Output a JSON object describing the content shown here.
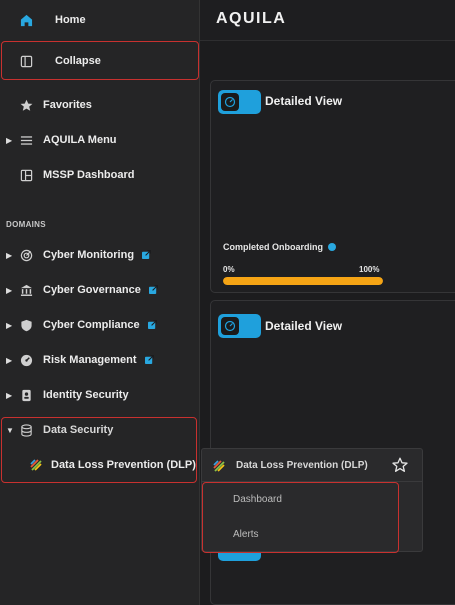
{
  "sidebar": {
    "top_items": [
      {
        "label": "Home",
        "icon": "home-icon"
      },
      {
        "label": "Collapse",
        "icon": "sidebar-panel-icon"
      },
      {
        "label": "Favorites",
        "icon": "star-icon"
      },
      {
        "label": "AQUILA Menu",
        "icon": "hamburger-menu-icon"
      },
      {
        "label": "MSSP Dashboard",
        "icon": "dashboard-layout-icon"
      }
    ],
    "domains_header": "DOMAINS",
    "domains": [
      {
        "label": "Cyber Monitoring",
        "icon": "radar-icon"
      },
      {
        "label": "Cyber Governance",
        "icon": "bank-building-icon"
      },
      {
        "label": "Cyber Compliance",
        "icon": "shield-icon"
      },
      {
        "label": "Risk Management",
        "icon": "gauge-icon"
      },
      {
        "label": "Identity Security",
        "icon": "id-badge-icon"
      },
      {
        "label": "Data Security",
        "icon": "database-icon"
      }
    ],
    "sub_item": {
      "label": "Data Loss Prevention (DLP)",
      "icon": "dlp-stripes-icon"
    }
  },
  "topbar": {
    "logo": "AQUILA"
  },
  "cards": [
    {
      "title": "Detailed View"
    },
    {
      "title": "Detailed View"
    }
  ],
  "onboarding": {
    "label": "Completed Onboarding",
    "min_label": "0%",
    "max_label": "100%",
    "progress_fraction": 1.0
  },
  "flyout": {
    "title": "Data Loss Prevention (DLP)",
    "items": [
      "Dashboard",
      "Alerts"
    ]
  },
  "colors": {
    "accent": "#29a8e0",
    "progress": "#f5a415",
    "highlight_border": "#c8312f"
  }
}
